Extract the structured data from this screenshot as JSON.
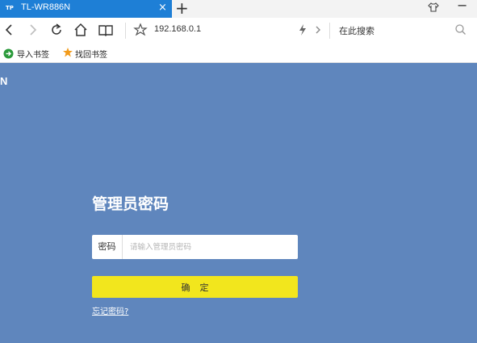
{
  "tab": {
    "favicon_text": "TP",
    "title": "TL-WR886N",
    "close_glyph": "×"
  },
  "new_tab_glyph": "+",
  "address_bar": {
    "url": "192.168.0.1",
    "search_placeholder": "在此搜索"
  },
  "bookmarks": [
    {
      "label": "导入书签",
      "icon": "import-icon"
    },
    {
      "label": "找回书签",
      "icon": "star-icon"
    }
  ],
  "page": {
    "brand_fragment": "N",
    "login_title": "管理员密码",
    "password_label": "密码",
    "password_placeholder": "请输入管理员密码",
    "password_value": "",
    "confirm_label": "确定",
    "forgot_link": "忘记密码?"
  },
  "colors": {
    "background": "#5f86bd",
    "tab_active": "#1e7fd6",
    "confirm_button": "#f2e61d",
    "star": "#f29b1b",
    "import_icon": "#2b9a3b"
  }
}
